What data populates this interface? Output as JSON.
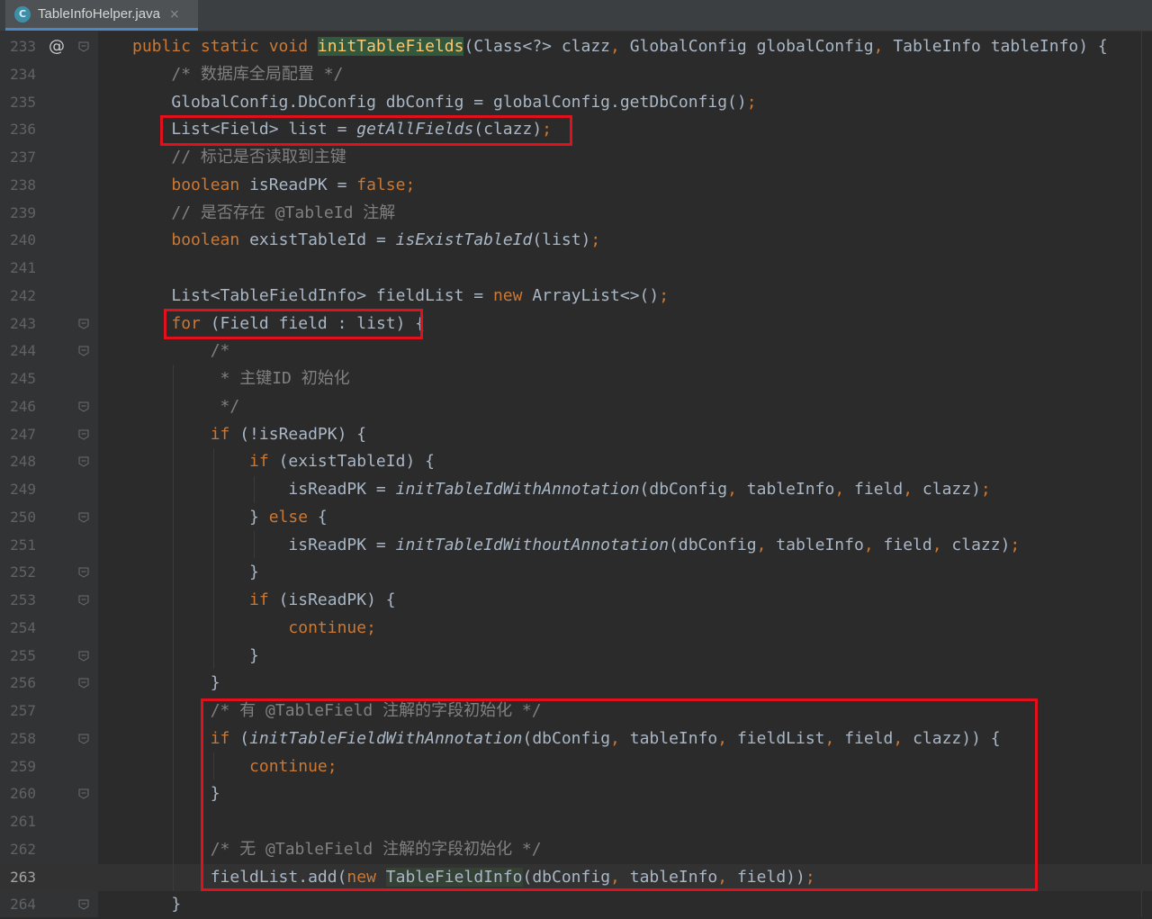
{
  "tab": {
    "icon_letter": "C",
    "title": "TableInfoHelper.java",
    "close": "×"
  },
  "gutter_marker": "@",
  "lines": [
    {
      "n": "233",
      "tokens": [
        [
          "kw",
          "public static void "
        ],
        [
          "fnhl",
          "initTableFields"
        ],
        [
          "t",
          "(Class<?> clazz"
        ],
        [
          "kw",
          ", "
        ],
        [
          "t",
          "GlobalConfig globalConfig"
        ],
        [
          "kw",
          ", "
        ],
        [
          "t",
          "TableInfo tableInfo) {"
        ]
      ]
    },
    {
      "n": "234",
      "tokens": [
        [
          "t",
          "    "
        ],
        [
          "cm",
          "/* 数据库全局配置 */"
        ]
      ]
    },
    {
      "n": "235",
      "tokens": [
        [
          "t",
          "    GlobalConfig.DbConfig dbConfig = globalConfig.getDbConfig()"
        ],
        [
          "kw",
          ";"
        ]
      ]
    },
    {
      "n": "236",
      "tokens": [
        [
          "t",
          "    List<Field> list = "
        ],
        [
          "it",
          "getAllFields"
        ],
        [
          "t",
          "(clazz)"
        ],
        [
          "kw",
          ";"
        ]
      ]
    },
    {
      "n": "237",
      "tokens": [
        [
          "t",
          "    "
        ],
        [
          "cm",
          "// 标记是否读取到主键"
        ]
      ]
    },
    {
      "n": "238",
      "tokens": [
        [
          "t",
          "    "
        ],
        [
          "kw",
          "boolean "
        ],
        [
          "t",
          "isReadPK = "
        ],
        [
          "kw",
          "false;"
        ]
      ]
    },
    {
      "n": "239",
      "tokens": [
        [
          "t",
          "    "
        ],
        [
          "cm",
          "// 是否存在 @TableId 注解"
        ]
      ]
    },
    {
      "n": "240",
      "tokens": [
        [
          "t",
          "    "
        ],
        [
          "kw",
          "boolean "
        ],
        [
          "t",
          "existTableId = "
        ],
        [
          "it",
          "isExistTableId"
        ],
        [
          "t",
          "(list)"
        ],
        [
          "kw",
          ";"
        ]
      ]
    },
    {
      "n": "241",
      "tokens": []
    },
    {
      "n": "242",
      "tokens": [
        [
          "t",
          "    List<TableFieldInfo> fieldList = "
        ],
        [
          "kw",
          "new "
        ],
        [
          "t",
          "ArrayList<>()"
        ],
        [
          "kw",
          ";"
        ]
      ]
    },
    {
      "n": "243",
      "tokens": [
        [
          "t",
          "    "
        ],
        [
          "kw",
          "for "
        ],
        [
          "t",
          "(Field field : list) {"
        ]
      ]
    },
    {
      "n": "244",
      "tokens": [
        [
          "t",
          "        "
        ],
        [
          "cm",
          "/*"
        ]
      ]
    },
    {
      "n": "245",
      "tokens": [
        [
          "t",
          "        "
        ],
        [
          "cm",
          " * 主键ID 初始化"
        ]
      ]
    },
    {
      "n": "246",
      "tokens": [
        [
          "t",
          "        "
        ],
        [
          "cm",
          " */"
        ]
      ]
    },
    {
      "n": "247",
      "tokens": [
        [
          "t",
          "        "
        ],
        [
          "kw",
          "if "
        ],
        [
          "t",
          "(!isReadPK) {"
        ]
      ]
    },
    {
      "n": "248",
      "tokens": [
        [
          "t",
          "            "
        ],
        [
          "kw",
          "if "
        ],
        [
          "t",
          "(existTableId) {"
        ]
      ]
    },
    {
      "n": "249",
      "tokens": [
        [
          "t",
          "                isReadPK = "
        ],
        [
          "it",
          "initTableIdWithAnnotation"
        ],
        [
          "t",
          "(dbConfig"
        ],
        [
          "kw",
          ", "
        ],
        [
          "t",
          "tableInfo"
        ],
        [
          "kw",
          ", "
        ],
        [
          "t",
          "field"
        ],
        [
          "kw",
          ", "
        ],
        [
          "t",
          "clazz)"
        ],
        [
          "kw",
          ";"
        ]
      ]
    },
    {
      "n": "250",
      "tokens": [
        [
          "t",
          "            } "
        ],
        [
          "kw",
          "else "
        ],
        [
          "t",
          "{"
        ]
      ]
    },
    {
      "n": "251",
      "tokens": [
        [
          "t",
          "                isReadPK = "
        ],
        [
          "it",
          "initTableIdWithoutAnnotation"
        ],
        [
          "t",
          "(dbConfig"
        ],
        [
          "kw",
          ", "
        ],
        [
          "t",
          "tableInfo"
        ],
        [
          "kw",
          ", "
        ],
        [
          "t",
          "field"
        ],
        [
          "kw",
          ", "
        ],
        [
          "t",
          "clazz)"
        ],
        [
          "kw",
          ";"
        ]
      ]
    },
    {
      "n": "252",
      "tokens": [
        [
          "t",
          "            }"
        ]
      ]
    },
    {
      "n": "253",
      "tokens": [
        [
          "t",
          "            "
        ],
        [
          "kw",
          "if "
        ],
        [
          "t",
          "(isReadPK) {"
        ]
      ]
    },
    {
      "n": "254",
      "tokens": [
        [
          "t",
          "                "
        ],
        [
          "kw",
          "continue;"
        ]
      ]
    },
    {
      "n": "255",
      "tokens": [
        [
          "t",
          "            }"
        ]
      ]
    },
    {
      "n": "256",
      "tokens": [
        [
          "t",
          "        }"
        ]
      ]
    },
    {
      "n": "257",
      "tokens": [
        [
          "t",
          "        "
        ],
        [
          "cm",
          "/* 有 @TableField 注解的字段初始化 */"
        ]
      ]
    },
    {
      "n": "258",
      "tokens": [
        [
          "t",
          "        "
        ],
        [
          "kw",
          "if "
        ],
        [
          "t",
          "("
        ],
        [
          "it",
          "initTableFieldWithAnnotation"
        ],
        [
          "t",
          "(dbConfig"
        ],
        [
          "kw",
          ", "
        ],
        [
          "t",
          "tableInfo"
        ],
        [
          "kw",
          ", "
        ],
        [
          "t",
          "fieldList"
        ],
        [
          "kw",
          ", "
        ],
        [
          "t",
          "field"
        ],
        [
          "kw",
          ", "
        ],
        [
          "t",
          "clazz)) {"
        ]
      ]
    },
    {
      "n": "259",
      "tokens": [
        [
          "t",
          "            "
        ],
        [
          "kw",
          "continue;"
        ]
      ]
    },
    {
      "n": "260",
      "tokens": [
        [
          "t",
          "        }"
        ]
      ]
    },
    {
      "n": "261",
      "tokens": []
    },
    {
      "n": "262",
      "tokens": [
        [
          "t",
          "        "
        ],
        [
          "cm",
          "/* 无 @TableField 注解的字段初始化 */"
        ]
      ]
    },
    {
      "n": "263",
      "tokens": [
        [
          "t",
          "        fieldList.add("
        ],
        [
          "kw",
          "new "
        ],
        [
          "cls",
          "TableFieldInfo"
        ],
        [
          "t",
          "(dbConfig"
        ],
        [
          "kw",
          ", "
        ],
        [
          "t",
          "tableInfo"
        ],
        [
          "kw",
          ", "
        ],
        [
          "t",
          "field))"
        ],
        [
          "kw",
          ";"
        ]
      ]
    },
    {
      "n": "264",
      "tokens": [
        [
          "t",
          "    }"
        ]
      ]
    }
  ],
  "current_line": "263",
  "fold_lines": [
    "233",
    "243",
    "244",
    "246",
    "247",
    "248",
    "250",
    "252",
    "253",
    "255",
    "256",
    "258",
    "260",
    "264"
  ]
}
